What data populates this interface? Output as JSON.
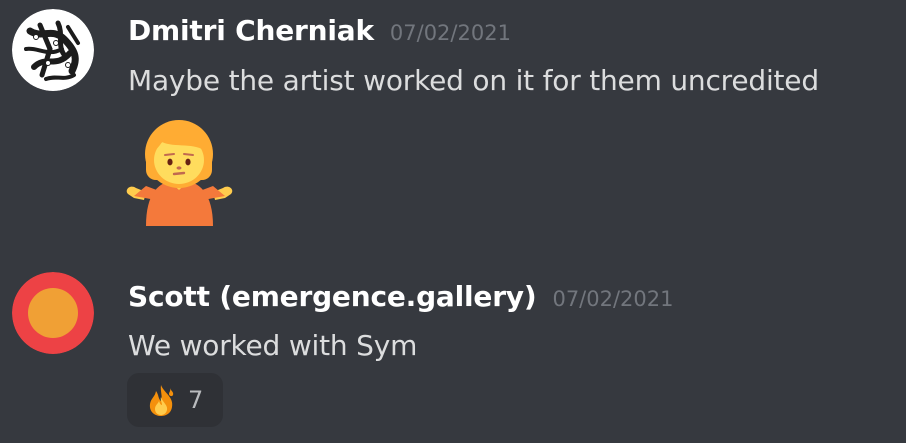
{
  "messages": [
    {
      "username": "Dmitri Cherniak",
      "timestamp": "07/02/2021",
      "text": "Maybe the artist worked on it for them uncredited",
      "avatar": "abstract-pattern-avatar",
      "emoji": "person-shrugging-emoji"
    },
    {
      "username": "Scott (emergence.gallery)",
      "timestamp": "07/02/2021",
      "text": "We worked with Sym",
      "avatar": "orange-circle-avatar",
      "reaction": {
        "emoji": "fire-emoji",
        "count": "7"
      }
    }
  ],
  "colors": {
    "background": "#36393f",
    "username": "#ffffff",
    "message_text": "#dcddde",
    "timestamp": "#72767d",
    "reaction_bg": "#2f3136",
    "avatar2_ring": "#ed4245",
    "avatar2_fill": "#f0a035"
  }
}
